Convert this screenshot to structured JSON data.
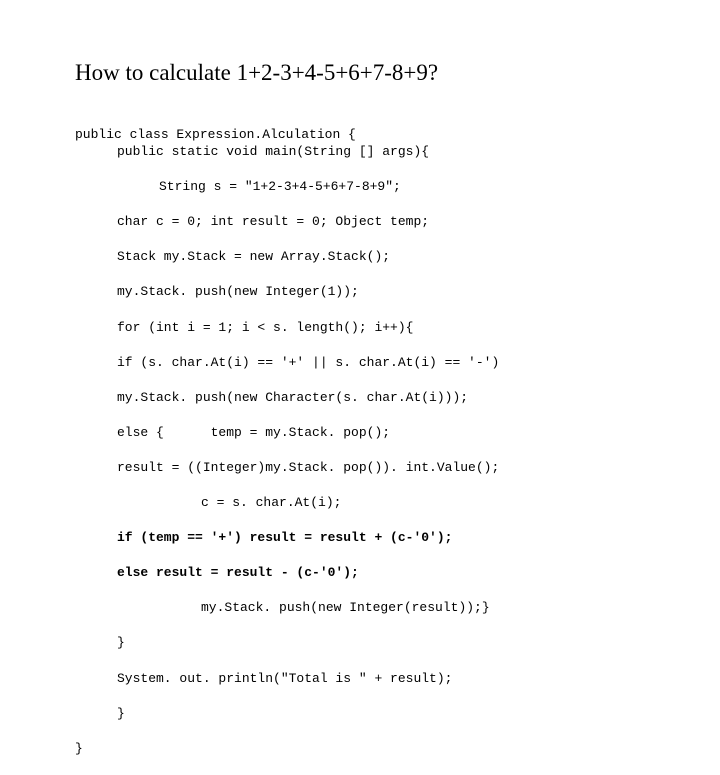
{
  "title": "How to calculate 1+2-3+4-5+6+7-8+9?",
  "code": {
    "l1": "public class Expression.Alculation {",
    "l2": "public static void main(String [] args){",
    "l3": "String s = \"1+2-3+4-5+6+7-8+9\";",
    "l4": "char c = 0; int result = 0; Object temp;",
    "l5": "Stack my.Stack = new Array.Stack();",
    "l6": "my.Stack. push(new Integer(1));",
    "l7": "for (int i = 1; i < s. length(); i++){",
    "l8": "if (s. char.At(i) == '+' || s. char.At(i) == '-')",
    "l9": "my.Stack. push(new Character(s. char.At(i)));",
    "l10a": "else {",
    "l10b": "temp = my.Stack. pop();",
    "l11": "result = ((Integer)my.Stack. pop()). int.Value();",
    "l12": "c = s. char.At(i);",
    "l13": "if (temp == '+') result = result + (c-'0');",
    "l14": "else result = result - (c-'0');",
    "l15": "my.Stack. push(new Integer(result));}",
    "l16": "}",
    "l17": "System. out. println(\"Total is \" + result);",
    "l18": "}",
    "l19": "}"
  }
}
